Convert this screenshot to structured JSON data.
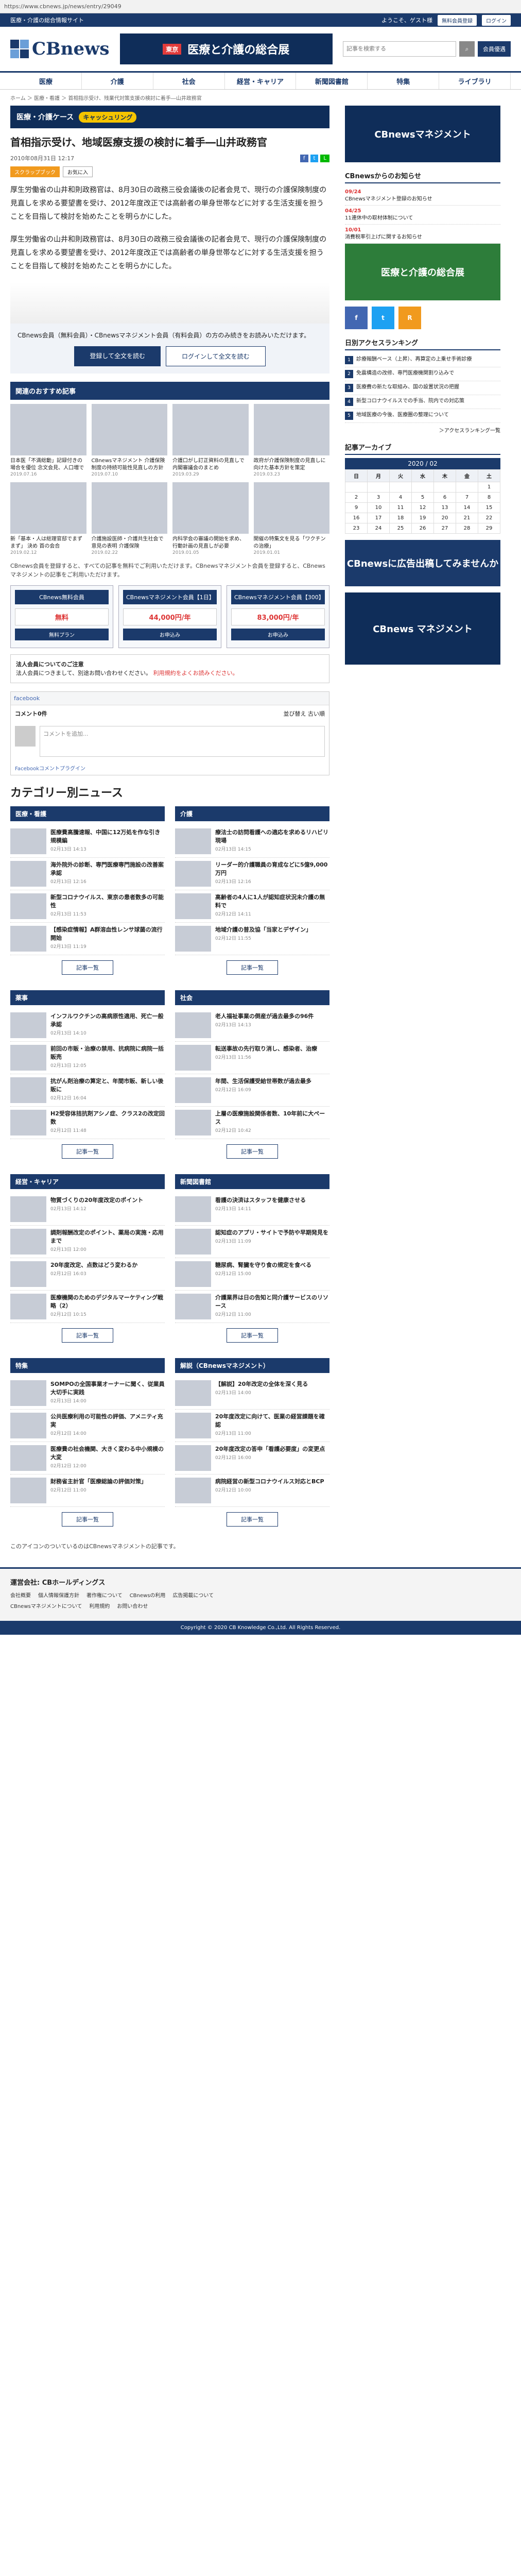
{
  "url": "https://www.cbnews.jp/news/entry/29049",
  "topbar": {
    "left": "医療・介護の総合情報サイト",
    "welcome": "ようこそ、ゲスト様",
    "register": "無料会員登録",
    "login": "ログイン"
  },
  "header": {
    "logo": "CBnews",
    "banner": "医療と介護の総合展",
    "banner_tag": "東京",
    "search_placeholder": "記事を検索する",
    "member_button": "会員優遇"
  },
  "nav": [
    "医療",
    "介護",
    "社会",
    "経営・キャリア",
    "新聞図書館",
    "特集",
    "ライブラリ"
  ],
  "breadcrumb": "ホーム ＞ 医療・看護 ＞ 首相指示受け、残業代対策支援の検討に着手―山井政務官",
  "sub_banner": {
    "text": "医療・介護ケース",
    "pill": "キャッシュリング"
  },
  "article": {
    "title": "首相指示受け、地域医療支援の検討に着手―山井政務官",
    "date": "2010年08月31日 12:17",
    "tags": [
      "スクラップブック",
      "お気に入"
    ],
    "paragraphs": [
      "厚生労働省の山井和則政務官は、8月30日の政務三役会議後の記者会見で、現行の介護保険制度の見直しを求める要望書を受け、2012年度改正では高齢者の単身世帯などに対する生活支援を担うことを目指して検討を始めたことを明らかにした。",
      "厚生労働省の山井和則政務官は、8月30日の政務三役会議後の記者会見で、現行の介護保険制度の見直しを求める要望書を受け、2012年度改正では高齢者の単身世帯などに対する生活支援を担うことを目指して検討を始めたことを明らかにした。"
    ]
  },
  "paywall": {
    "text": "CBnews会員（無料会員）・CBnewsマネジメント会員（有料会員）の方のみ続きをお読みいただけます。",
    "primary": "登録して全文を読む",
    "secondary": "ログインして全文を読む"
  },
  "recommend": {
    "heading": "関連のおすすめ記事",
    "items": [
      {
        "t": "日本医「不満総動」記録付きの場合を優位 念文会見、人口増で",
        "d": "2019.07.16"
      },
      {
        "t": "CBnewsマネジメント 介護保険制度の持続可能性見直しの方針",
        "d": "2019.07.10"
      },
      {
        "t": "介護口がし訂正資料の見直しで内閣審議会のまとめ",
        "d": "2019.03.29"
      },
      {
        "t": "政府が介護保険制度の見直しに向けた基本方針を策定",
        "d": "2019.03.23"
      },
      {
        "t": "新「基本・人は総理官邸でまずまず」 決め 首の会合",
        "d": "2019.02.12"
      },
      {
        "t": "介護施設医師・介護共生社会で意見の表明 介護保険",
        "d": "2019.02.22"
      },
      {
        "t": "内科学会の審議の開始を求め、行動計画の見直しが必要",
        "d": "2019.01.05"
      },
      {
        "t": "開催の特集文を見る「ワクチンの治療」",
        "d": "2019.01.01"
      }
    ]
  },
  "plans_note": "CBnews会員を登録すると、すべての記事を無料でご利用いただけます。CBnewsマネジメント会員を登録すると、CBnewsマネジメントの記事をご利用いただけます。",
  "plans": [
    {
      "name": "CBnews無料会員",
      "price": "無料",
      "cta": "無料プラン"
    },
    {
      "name": "CBnewsマネジメント会員【1日】",
      "price": "44,000円/年",
      "cta": "お申込み"
    },
    {
      "name": "CBnewsマネジメント会員【300】",
      "price": "83,000円/年",
      "cta": "お申込み"
    }
  ],
  "corp": {
    "heading": "法人会員についてのご注意",
    "text": "法人会員につきまして、別途お問い合わせください。",
    "red": "利用規約をよくお読みください。"
  },
  "facebook": {
    "title": "facebook",
    "comments": "コメント0件",
    "sort": "並び替え 古い順",
    "placeholder": "コメントを追加...",
    "plugin": "Facebookコメントプラグイン"
  },
  "category_title": "カテゴリー別ニュース",
  "categories": [
    {
      "name": "医療・看護",
      "items": [
        {
          "t": "医療費高騰速報、中国に12万処を作な引き規模編",
          "d": "02月13日 14:13"
        },
        {
          "t": "海外院外の診断、専門医療専門施設の改善案承認",
          "d": "02月13日 12:16"
        },
        {
          "t": "新型コロナウイルス、東京の患者数多の可能性",
          "d": "02月13日 11:53"
        },
        {
          "t": "【感染症情報】A群溶血性レンサ球菌の流行開始",
          "d": "02月13日 11:19"
        }
      ]
    },
    {
      "name": "介護",
      "items": [
        {
          "t": "療法士の訪問看護への適応を求めるリハビリ現場",
          "d": "02月13日 14:15"
        },
        {
          "t": "リーダー的介護職員の育成などに5億9,000万円",
          "d": "02月13日 12:16"
        },
        {
          "t": "高齢者の4人に1人が認知症状況未介護の無料で",
          "d": "02月12日 14:11"
        },
        {
          "t": "地域介護の普及協「当家とデザイン」",
          "d": "02月12日 11:55"
        }
      ]
    },
    {
      "name": "薬事",
      "items": [
        {
          "t": "インフルワクチンの高病原性適用、死亡一般承認",
          "d": "02月13日 14:10"
        },
        {
          "t": "前回の市販・治療の禁用、抗病院に病院一括販売",
          "d": "02月13日 12:05"
        },
        {
          "t": "抗がん剤治療の算定と、年間市販、新しい後販に",
          "d": "02月12日 16:04"
        },
        {
          "t": "H2受容体拮抗剤アシノ症、クラス2の改定回数",
          "d": "02月12日 11:48"
        }
      ]
    },
    {
      "name": "社会",
      "items": [
        {
          "t": "老人福祉事業の倒産が過去最多の96件",
          "d": "02月13日 14:13"
        },
        {
          "t": "転送事故の先行取り消し、感染者、治療",
          "d": "02月13日 11:56"
        },
        {
          "t": "年間、生活保護受給世帯数が過去最多",
          "d": "02月12日 16:09"
        },
        {
          "t": "上層の医療施設関係者数、10年前に大ペース",
          "d": "02月12日 10:42"
        }
      ]
    },
    {
      "name": "経営・キャリア",
      "items": [
        {
          "t": "物質づくりの20年度改定のポイント",
          "d": "02月13日 14:12"
        },
        {
          "t": "調剤報酬改定のポイント、薬局の実施・応用まで",
          "d": "02月13日 12:00"
        },
        {
          "t": "20年度改定、点数はどう変わるか",
          "d": "02月12日 16:03"
        },
        {
          "t": "医療機関のためのデジタルマーケティング戦略（2）",
          "d": "02月12日 10:15"
        }
      ]
    },
    {
      "name": "新聞図書館",
      "items": [
        {
          "t": "看護の決済はスタッフを健康させる",
          "d": "02月13日 14:11"
        },
        {
          "t": "認知症のアプリ・サイトで予防や早期発見を",
          "d": "02月13日 11:09"
        },
        {
          "t": "糖尿病、腎臓を守り食の規定を食べる",
          "d": "02月12日 15:00"
        },
        {
          "t": "介護業界は日の告知と同介護サービスのリソース",
          "d": "02月12日 11:00"
        }
      ]
    },
    {
      "name": "特集",
      "items": [
        {
          "t": "SOMPOの全国事業オーナーに聞く、従業員大切手に実践",
          "d": "02月13日 14:00"
        },
        {
          "t": "公共医療利用の可能性の評価、アメニティ充実",
          "d": "02月12日 14:00"
        },
        {
          "t": "医療費の社会機関、大きく変わる中小規模の大変",
          "d": "02月12日 12:00"
        },
        {
          "t": "財務省主計官「医療総論の評価対策」",
          "d": "02月12日 11:00"
        }
      ]
    },
    {
      "name": "解説（CBnewsマネジメント）",
      "items": [
        {
          "t": "【解説】20年改定の全体を深く見る",
          "d": "02月13日 14:00"
        },
        {
          "t": "20年度改定に向けて、医業の経営課題を確認",
          "d": "02月13日 11:00"
        },
        {
          "t": "20年度改定の答申「看護必要度」の変更点",
          "d": "02月12日 16:00"
        },
        {
          "t": "病院経営の新型コロナウイルス対応とBCP",
          "d": "02月12日 10:00"
        }
      ]
    }
  ],
  "more_label": "記事一覧",
  "bottom_note": "このアイコンのついているのはCBnewsマネジメントの記事です。",
  "sidebar": {
    "banner": "CBnewsマネジメント",
    "notice_heading": "CBnewsからのお知らせ",
    "notices": [
      {
        "d": "09/24",
        "t": "CBnewsマネジメント登録のお知らせ"
      },
      {
        "d": "04/25",
        "t": "11連休中の取材体制について"
      },
      {
        "d": "10/01",
        "t": "消費税率引上げに関するお知らせ"
      }
    ],
    "ranking_heading": "日別アクセスランキング",
    "ranking": [
      "診療報酬ベース（上昇）、再算定の上乗せ手術診療",
      "免震構造の改修、専門医療機関割り込みで",
      "医療費の新たな取組み、国の設置状況の把握",
      "新型コロナウイルスでの手当、院内での対応策",
      "地域医療の今後、医療圏の整理について"
    ],
    "ranking_more": "＞アクセスランキング一覧",
    "calendar_heading": "記事アーカイブ",
    "calendar_month": "2020 / 02",
    "weekdays": [
      "日",
      "月",
      "火",
      "水",
      "木",
      "金",
      "土"
    ],
    "weeks": [
      [
        "",
        "",
        "",
        "",
        "",
        "",
        "1"
      ],
      [
        "2",
        "3",
        "4",
        "5",
        "6",
        "7",
        "8"
      ],
      [
        "9",
        "10",
        "11",
        "12",
        "13",
        "14",
        "15"
      ],
      [
        "16",
        "17",
        "18",
        "19",
        "20",
        "21",
        "22"
      ],
      [
        "23",
        "24",
        "25",
        "26",
        "27",
        "28",
        "29"
      ]
    ],
    "ad1": "医療と介護の総合展",
    "ad2": "CBnewsに広告出稿してみませんか",
    "ad3": "CBnews マネジメント"
  },
  "footer": {
    "heading": "運営会社: CBホールディングス",
    "links1": [
      "会社概要",
      "個人情報保護方針",
      "著作権について",
      "CBnewsの利用",
      "広告掲載について"
    ],
    "links2": [
      "CBnewsマネジメントについて",
      "利用規約",
      "お問い合わせ"
    ],
    "copyright": "Copyright © 2020 CB Knowledge Co.,Ltd. All Rights Reserved."
  }
}
